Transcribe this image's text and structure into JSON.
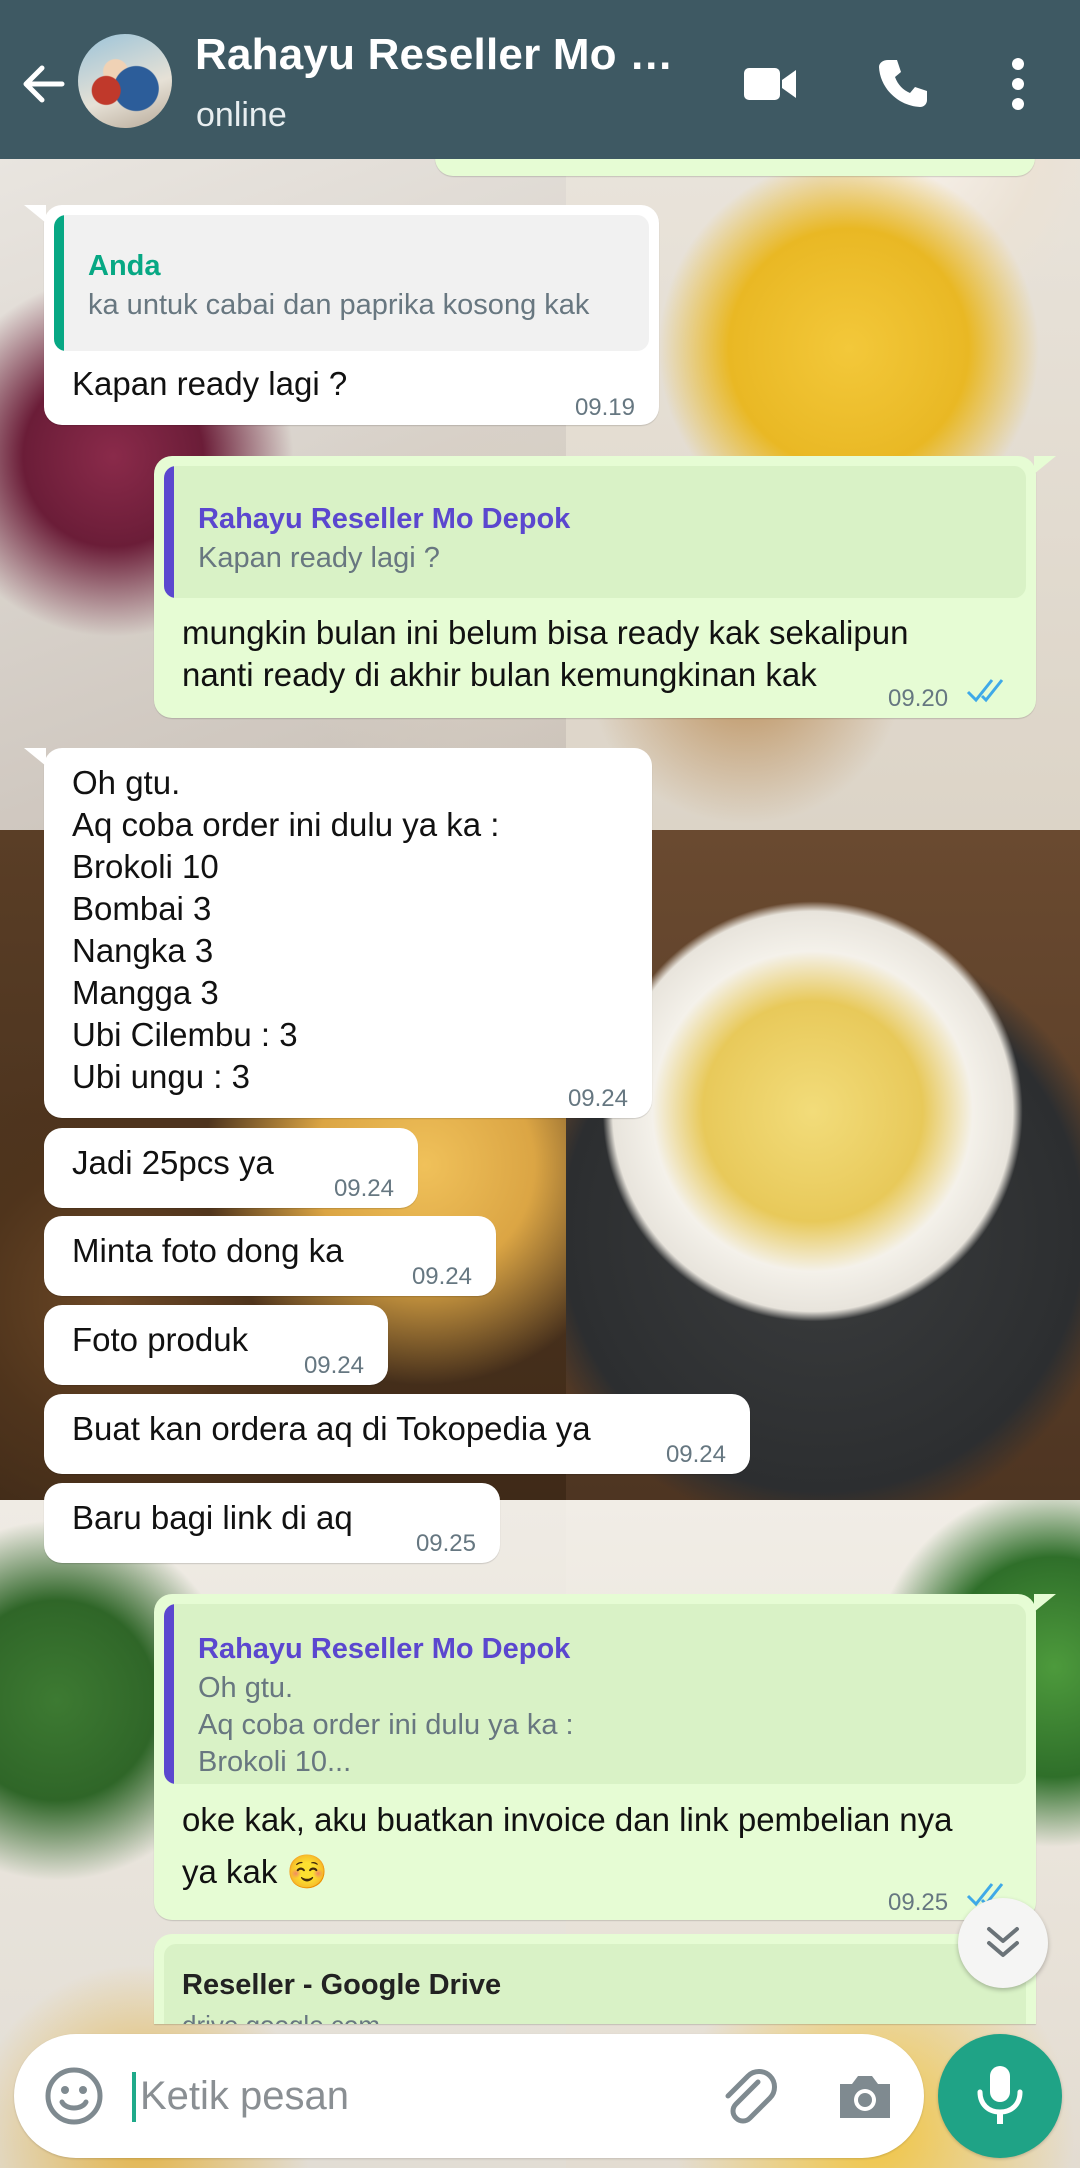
{
  "header": {
    "title": "Rahayu Reseller Mo Depok",
    "status": "online"
  },
  "colors": {
    "header_bg": "#3e5963",
    "outgoing_bubble": "#e6fcd4",
    "incoming_bubble": "#ffffff",
    "accent_green": "#1fa386",
    "read_ticks": "#3fa9e8"
  },
  "icons": {
    "back": "arrow-left-icon",
    "video": "video-camera-icon",
    "call": "phone-icon",
    "more": "more-vertical-icon",
    "emoji": "emoji-icon",
    "attach": "paperclip-icon",
    "camera": "camera-icon",
    "mic": "microphone-icon",
    "scroll": "double-chevron-down-icon"
  },
  "messages": [
    {
      "direction": "in",
      "quote_name": "Anda",
      "quote_text": "ka untuk cabai dan paprika kosong kak",
      "text": "Kapan ready lagi ?",
      "time": "09.19"
    },
    {
      "direction": "out",
      "quote_name": "Rahayu Reseller Mo Depok",
      "quote_text": "Kapan ready lagi ?",
      "text": "mungkin bulan ini belum bisa ready kak sekalipun\nnanti ready di akhir bulan kemungkinan kak",
      "time": "09.20",
      "status": "read"
    },
    {
      "direction": "in",
      "text": "Oh gtu.\nAq coba order ini dulu ya ka :\nBrokoli 10\nBombai 3\nNangka 3\nMangga 3\nUbi Cilembu : 3\nUbi ungu : 3",
      "time": "09.24"
    },
    {
      "direction": "in",
      "text": "Jadi 25pcs ya",
      "time": "09.24"
    },
    {
      "direction": "in",
      "text": "Minta foto dong ka",
      "time": "09.24"
    },
    {
      "direction": "in",
      "text": "Foto produk",
      "time": "09.24"
    },
    {
      "direction": "in",
      "text": "Buat kan ordera aq di Tokopedia ya",
      "time": "09.24"
    },
    {
      "direction": "in",
      "text": "Baru bagi link di aq",
      "time": "09.25"
    },
    {
      "direction": "out",
      "quote_name": "Rahayu Reseller Mo Depok",
      "quote_text": "Oh gtu.\nAq coba order ini dulu ya ka :\nBrokoli 10...",
      "text": "oke kak, aku buatkan invoice dan link pembelian nya\nya kak ☺️",
      "time": "09.25",
      "status": "read"
    },
    {
      "direction": "out",
      "link_title": "Reseller - Google Drive",
      "link_domain": "drive.google.com"
    }
  ],
  "input": {
    "placeholder": "Ketik pesan",
    "value": ""
  }
}
